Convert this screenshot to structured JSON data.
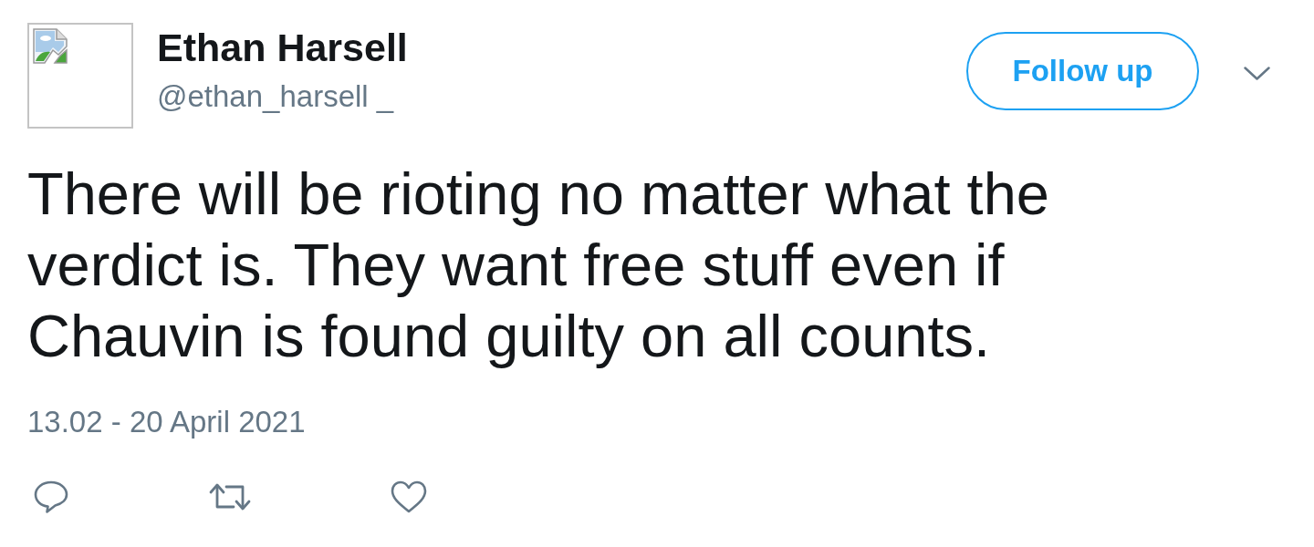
{
  "author": {
    "name": "Ethan Harsell",
    "handle": "@ethan_harsell _"
  },
  "follow_button": {
    "label": "Follow up"
  },
  "tweet": {
    "text": "There will be rioting no matter what the verdict is. They want free stuff even if Chauvin is found guilty on all counts.",
    "timestamp": "13.02 - 20 April 2021"
  }
}
